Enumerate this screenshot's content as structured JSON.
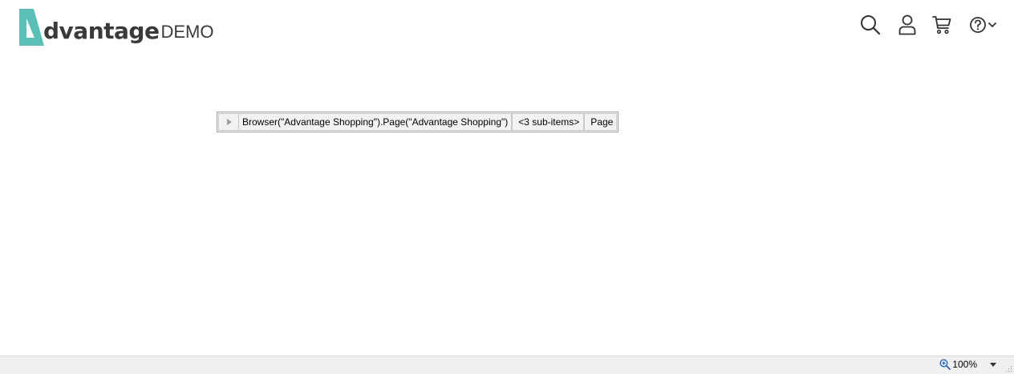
{
  "header": {
    "logo_text": "dvantage",
    "logo_suffix": "DEMO",
    "brand_color": "#5bbfb5",
    "icons": [
      "search-icon",
      "user-icon",
      "cart-icon",
      "help-icon",
      "chevron-down-icon"
    ]
  },
  "spy_row": {
    "object_path": "Browser(\"Advantage Shopping\").Page(\"Advantage Shopping\")",
    "sub_items": "<3 sub-items>",
    "type": "Page"
  },
  "status_bar": {
    "zoom_level": "100%"
  }
}
